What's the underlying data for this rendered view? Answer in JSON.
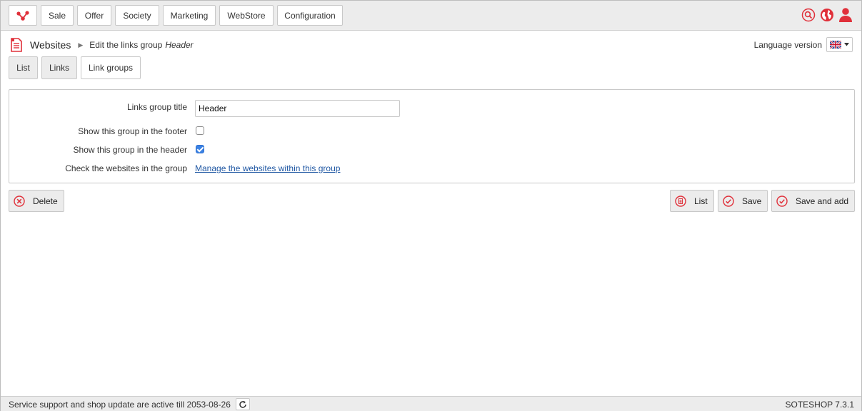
{
  "nav": {
    "items": [
      "Sale",
      "Offer",
      "Society",
      "Marketing",
      "WebStore",
      "Configuration"
    ]
  },
  "colors": {
    "accent": "#e0303a",
    "link": "#1f57a3",
    "checkbox": "#3b82e4"
  },
  "breadcrumb": {
    "section": "Websites",
    "page_prefix": "Edit the links group",
    "page_item": "Header"
  },
  "language": {
    "label": "Language version"
  },
  "tabs": [
    "List",
    "Links",
    "Link groups"
  ],
  "form": {
    "title_label": "Links group title",
    "title_value": "Header",
    "footer_label": "Show this group in the footer",
    "footer_checked": false,
    "header_label": "Show this group in the header",
    "header_checked": true,
    "websites_label": "Check the websites in the group",
    "websites_link": "Manage the websites within this group"
  },
  "actions": {
    "delete": "Delete",
    "list": "List",
    "save": "Save",
    "save_add": "Save and add"
  },
  "footer": {
    "status": "Service support and shop update are active till 2053-08-26",
    "version": "SOTESHOP 7.3.1"
  }
}
